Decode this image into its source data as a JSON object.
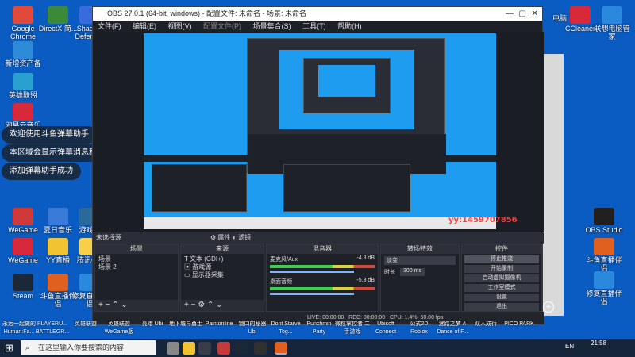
{
  "desktop": {
    "left_icons": [
      {
        "label": "Google Chrome",
        "color": "#e04a3a"
      },
      {
        "label": "DirectX 简...",
        "color": "#3a8a3a"
      },
      {
        "label": "Shadow Defender",
        "color": "#3a6adf"
      },
      {
        "label": "新增资产备",
        "color": "#2f8bd8"
      },
      {
        "label": "英雄联盟",
        "color": "#2aa0d0"
      },
      {
        "label": "网易云音乐",
        "color": "#d8293a"
      },
      {
        "label": "WeGame",
        "color": "#d8293a"
      },
      {
        "label": "YY直播",
        "color": "#f1c232"
      },
      {
        "label": "腾讯QQ",
        "color": "#f7d04a"
      },
      {
        "label": "WeGame",
        "color": "#d0393a"
      },
      {
        "label": "斗鱼直播伴侣",
        "color": "#e06020"
      },
      {
        "label": "修复直播伴侣",
        "color": "#2a88dd"
      },
      {
        "label": "Steam",
        "color": "#1b2838"
      },
      {
        "label": "夏日音乐",
        "color": "#3a7ad8"
      },
      {
        "label": "游戏盒",
        "color": "#2a6a9a"
      }
    ],
    "bottom_row": [
      "永远一起做的 Human:Fa...",
      "PLAYERU... BATTLEGR...",
      "英雄联盟",
      "英雄联盟 WeGame版",
      "亮暗 Ubi",
      "地下城与勇士",
      "Paintonline",
      "锁口的秘器 Ubi",
      "Dont Starve Tog...",
      "Punchmin Party",
      "微粒掌控者 二手游戏",
      "Ubisoft Connect",
      "公式2D Roblox",
      "迷路之梦 A Dance of F...",
      "双人成行",
      "PICO PARK"
    ],
    "right_icons": [
      {
        "label": "电脑",
        "color": "#3a7ad8"
      },
      {
        "label": "CCleaner",
        "color": "#d8293a"
      },
      {
        "label": "联想电脑管家",
        "color": "#2a88dd"
      },
      {
        "label": "OBS Studio",
        "color": "#202020"
      },
      {
        "label": "斗鱼直播伴侣",
        "color": "#e06020"
      },
      {
        "label": "修复直播伴侣",
        "color": "#2a88dd"
      }
    ]
  },
  "toasts": [
    "欢迎使用斗鱼弹幕助手",
    "本区域会显示弹幕消息和礼物消息",
    "添加弹幕助手成功"
  ],
  "obs": {
    "title": "OBS 27.0.1 (64-bit, windows) - 配置文件: 未命名 - 场景: 未命名",
    "menu": [
      "文件(F)",
      "编辑(E)",
      "视图(V)",
      "配置文件(P)",
      "场景集合(S)",
      "工具(T)",
      "帮助(H)"
    ],
    "selected_source": "未选择源",
    "filters_label": "属性",
    "filters2_label": "滤镜",
    "panels": {
      "scenes": {
        "title": "场景",
        "items": [
          "场景",
          "场景 2"
        ]
      },
      "sources": {
        "title": "来源",
        "items": [
          "文本 (GDI+)",
          "游戏源",
          "显示器采集"
        ]
      },
      "mixer": {
        "title": "混音器",
        "tracks": [
          {
            "name": "麦克风/Aux",
            "level": "-4.8 dB"
          },
          {
            "name": "桌面音频",
            "level": "-5.3 dB"
          }
        ]
      },
      "transitions": {
        "title": "转场特效",
        "type": "淡变",
        "duration_label": "时长",
        "duration": "300 ms"
      },
      "controls": {
        "title": "控件",
        "buttons": [
          "停止推流",
          "开始录制",
          "启动虚拟摄像机",
          "工作室模式",
          "设置",
          "退出"
        ]
      }
    },
    "status": {
      "live": "LIVE: 00:00:00",
      "rec": "REC: 00:00:00",
      "cpu": "CPU: 1.4%, 60.00 fps"
    }
  },
  "taskbar": {
    "search_placeholder": "在这里输入你要搜索的内容",
    "time": "21:58",
    "lang": "EN"
  },
  "watermark": "yy:1459707856"
}
